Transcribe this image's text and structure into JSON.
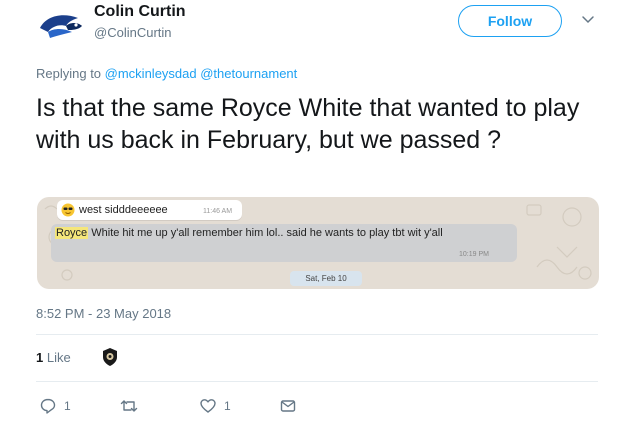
{
  "author": {
    "name": "Colin Curtin",
    "handle": "@ColinCurtin"
  },
  "follow_label": "Follow",
  "reply_context": {
    "prefix": "Replying to ",
    "mentions": [
      "@mckinleysdad",
      "@thetournament"
    ]
  },
  "tweet_text": "Is that the same Royce White that wanted to play with us back in February, but we passed ?",
  "media": {
    "message1": {
      "text": "west sidddeeeeee",
      "time": "11:46 AM"
    },
    "message2": {
      "highlight": "Royce",
      "text": " White hit me up y'all remember him lol.. said he wants to play tbt wit y'all",
      "time": "10:19 PM"
    },
    "date_label": "Sat, Feb 10"
  },
  "timestamp": "8:52 PM - 23 May 2018",
  "likes": {
    "count": "1",
    "label": "Like"
  },
  "actions": {
    "reply_count": "1",
    "retweet_count": "",
    "like_count": "1"
  },
  "colors": {
    "accent": "#1da1f2",
    "secondary_text": "#657786",
    "divider": "#e6ecf0"
  }
}
